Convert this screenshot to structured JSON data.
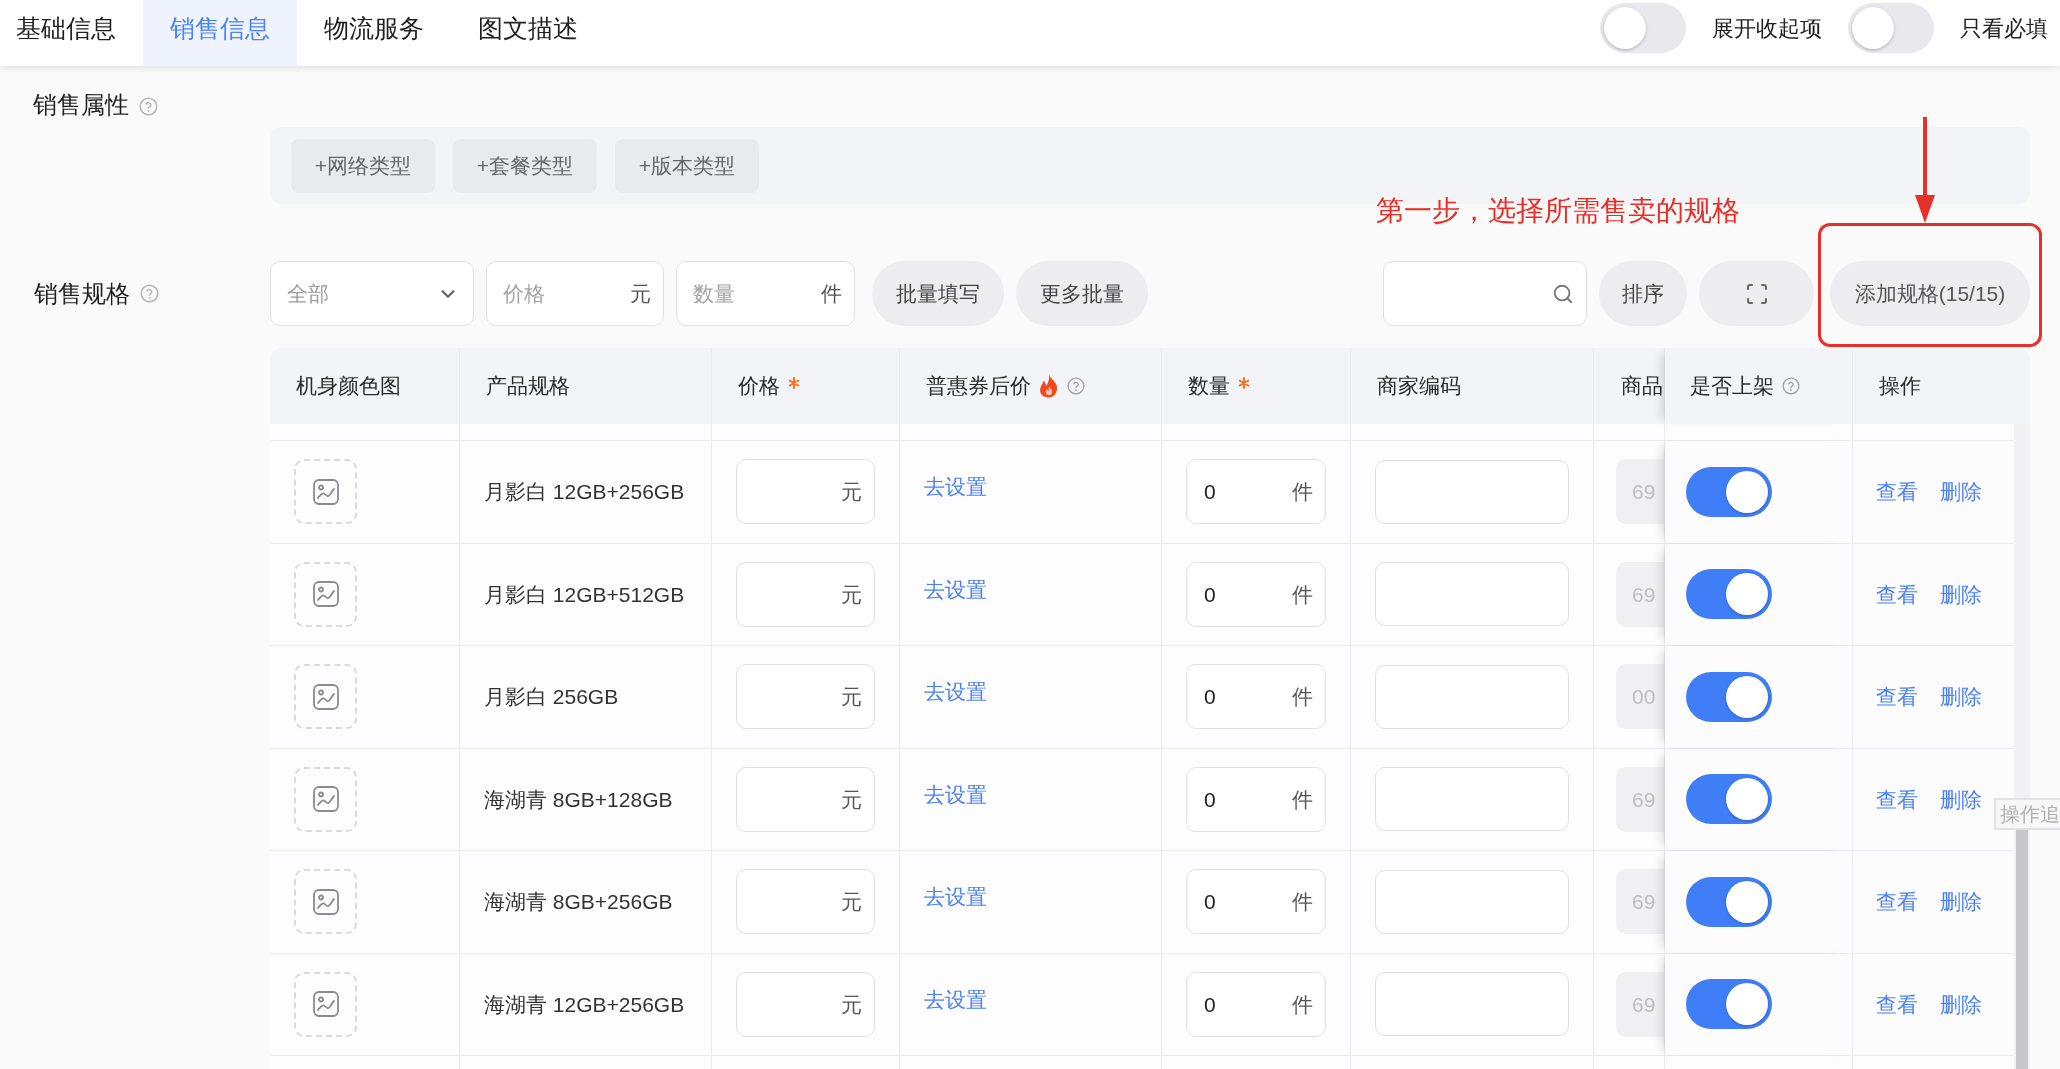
{
  "tabs": [
    {
      "label": "基础信息",
      "selected": false
    },
    {
      "label": "销售信息",
      "selected": true
    },
    {
      "label": "物流服务",
      "selected": false
    },
    {
      "label": "图文描述",
      "selected": false
    }
  ],
  "header_switches": [
    {
      "label": "展开收起项",
      "on": false
    },
    {
      "label": "只看必填",
      "on": false
    }
  ],
  "sales_attributes": {
    "label": "销售属性",
    "add_buttons": [
      "+网络类型",
      "+套餐类型",
      "+版本类型"
    ]
  },
  "annotation": "第一步，选择所需售卖的规格",
  "sales_specs": {
    "label": "销售规格",
    "filter_select": {
      "value": "全部"
    },
    "price_field": {
      "placeholder": "价格",
      "unit": "元"
    },
    "quantity_field": {
      "placeholder": "数量",
      "unit": "件"
    },
    "batch_buttons": [
      "批量填写",
      "更多批量"
    ],
    "sort_button": "排序",
    "add_button": "添加规格(15/15)"
  },
  "table": {
    "columns": [
      {
        "label": "机身颜色图",
        "required": false,
        "hot": false,
        "help": false
      },
      {
        "label": "产品规格",
        "required": false,
        "hot": false,
        "help": false
      },
      {
        "label": "价格",
        "required": true,
        "hot": false,
        "help": false
      },
      {
        "label": "普惠券后价",
        "required": false,
        "hot": true,
        "help": true
      },
      {
        "label": "数量",
        "required": true,
        "hot": false,
        "help": false
      },
      {
        "label": "商家编码",
        "required": false,
        "hot": false,
        "help": false
      },
      {
        "label": "商品",
        "required": false,
        "hot": false,
        "help": false
      },
      {
        "label": "是否上架",
        "required": false,
        "hot": false,
        "help": true
      },
      {
        "label": "操作",
        "required": false,
        "hot": false,
        "help": false
      }
    ],
    "rows": [
      {
        "spec": "月影白 12GB+256GB",
        "price_unit": "元",
        "coupon_price_action": "去设置",
        "quantity": "0",
        "quantity_unit": "件",
        "column_7": "69",
        "listed": true,
        "actions": [
          "查看",
          "删除"
        ]
      },
      {
        "spec": "月影白 12GB+512GB",
        "price_unit": "元",
        "coupon_price_action": "去设置",
        "quantity": "0",
        "quantity_unit": "件",
        "column_7": "69",
        "listed": true,
        "actions": [
          "查看",
          "删除"
        ]
      },
      {
        "spec": "月影白 256GB",
        "price_unit": "元",
        "coupon_price_action": "去设置",
        "quantity": "0",
        "quantity_unit": "件",
        "column_7": "00",
        "listed": true,
        "actions": [
          "查看",
          "删除"
        ]
      },
      {
        "spec": "海湖青 8GB+128GB",
        "price_unit": "元",
        "coupon_price_action": "去设置",
        "quantity": "0",
        "quantity_unit": "件",
        "column_7": "69",
        "listed": true,
        "actions": [
          "查看",
          "删除"
        ]
      },
      {
        "spec": "海湖青 8GB+256GB",
        "price_unit": "元",
        "coupon_price_action": "去设置",
        "quantity": "0",
        "quantity_unit": "件",
        "column_7": "69",
        "listed": true,
        "actions": [
          "查看",
          "删除"
        ]
      },
      {
        "spec": "海湖青 12GB+256GB",
        "price_unit": "元",
        "coupon_price_action": "去设置",
        "quantity": "0",
        "quantity_unit": "件",
        "column_7": "69",
        "listed": true,
        "actions": [
          "查看",
          "删除"
        ]
      }
    ]
  },
  "tooltip": "操作追"
}
